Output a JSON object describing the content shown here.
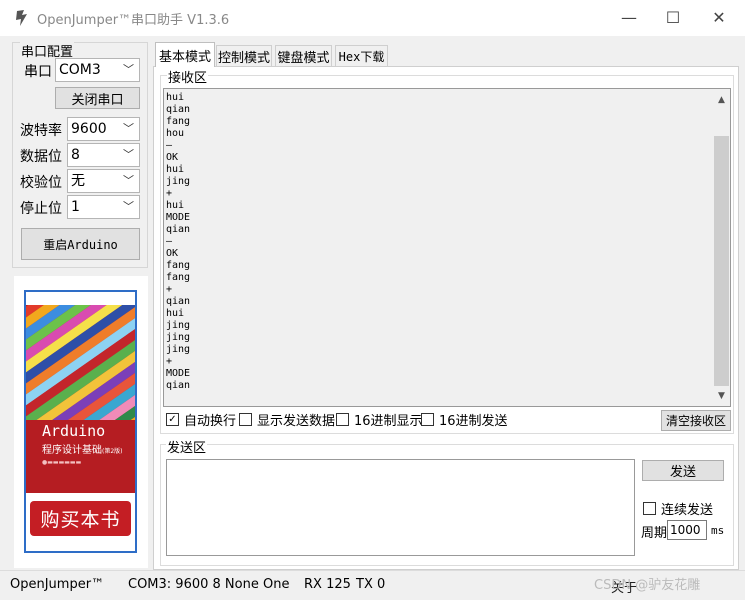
{
  "window": {
    "title": "OpenJumper™串口助手  V1.3.6",
    "min": "—",
    "max": "☐",
    "close": "✕"
  },
  "serial": {
    "legend": "串口配置",
    "port_label": "串口",
    "port_value": "COM3",
    "close_port": "关闭串口",
    "baud_label": "波特率",
    "baud_value": "9600",
    "databits_label": "数据位",
    "databits_value": "8",
    "parity_label": "校验位",
    "parity_value": "无",
    "stopbits_label": "停止位",
    "stopbits_value": "1",
    "restart": "重启Arduino"
  },
  "ad": {
    "book_title": "Arduino",
    "book_subtitle": "程序设计基础",
    "book_edition": "(第2版)",
    "buy": "购买本书"
  },
  "tabs": [
    "基本模式",
    "控制模式",
    "键盘模式",
    "Hex下载"
  ],
  "receive": {
    "legend": "接收区",
    "text": "hui\nqian\nfang\nhou\n—\nOK\nhui\njing\n+\nhui\nMODE\nqian\n—\nOK\nfang\nfang\n+\nqian\nhui\njing\njing\njing\n+\nMODE\nqian"
  },
  "options": {
    "auto_wrap": "自动换行",
    "auto_wrap_checked": "✓",
    "show_sent": "显示发送数据",
    "hex_display": "16进制显示",
    "hex_send": "16进制发送",
    "clear": "清空接收区"
  },
  "send": {
    "legend": "发送区",
    "send_button": "发送",
    "continuous": "连续发送",
    "period_label": "周期",
    "period_value": "1000",
    "period_unit": "ms"
  },
  "status": {
    "brand": "OpenJumper™",
    "port_info": "COM3: 9600 8 None One",
    "rx": "RX  125",
    "tx": "TX  0",
    "about": "关于",
    "watermark": "CSDN @驴友花雕"
  }
}
